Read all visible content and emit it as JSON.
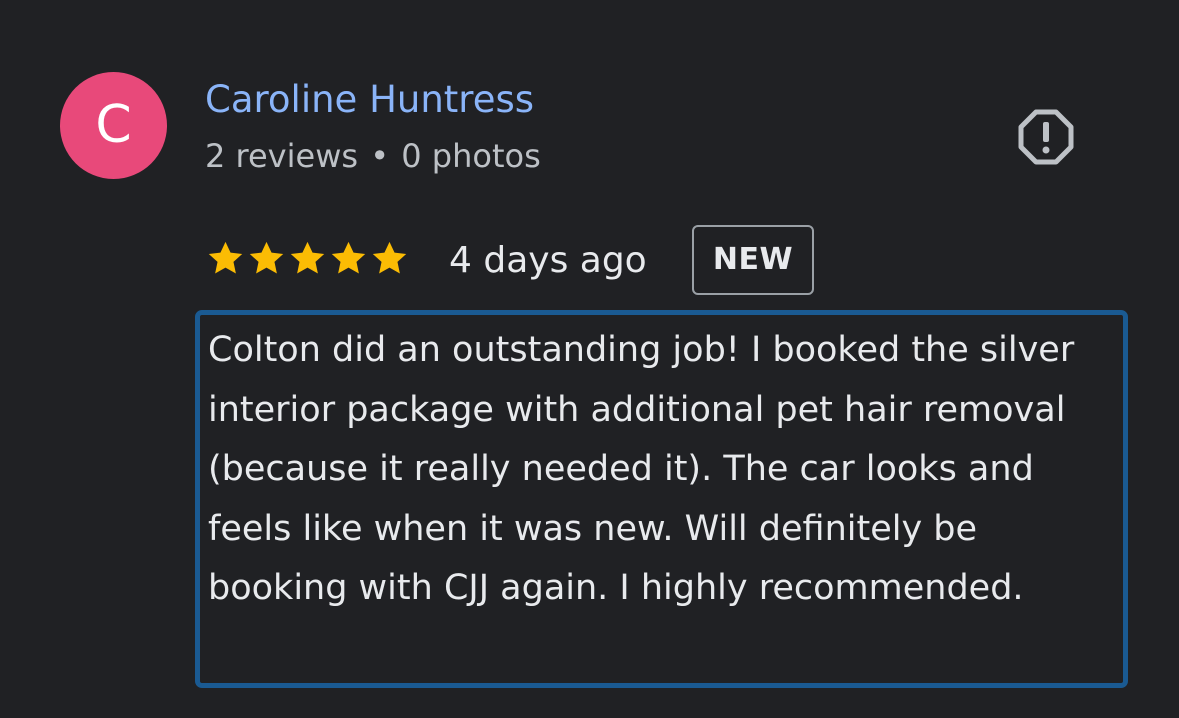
{
  "author": {
    "initial": "C",
    "name": "Caroline Huntress",
    "reviews_count": "2 reviews",
    "separator": "•",
    "photos_count": "0 photos",
    "avatar_color": "#e8497a",
    "name_color": "#8ab4f8"
  },
  "report": {
    "icon": "report-octagon-exclamation-icon"
  },
  "rating": {
    "stars": 5,
    "max_stars": 5,
    "star_color": "#fbbc04"
  },
  "meta": {
    "time_ago": "4 days ago",
    "badge": "NEW"
  },
  "review": {
    "text": "Colton did an outstanding job! I booked the silver interior package with additional pet hair removal (because it really needed it). The car looks and feels like when it was new. Will definitely be booking with CJJ again. I highly recommended.",
    "highlight_color": "#1a5a92"
  }
}
